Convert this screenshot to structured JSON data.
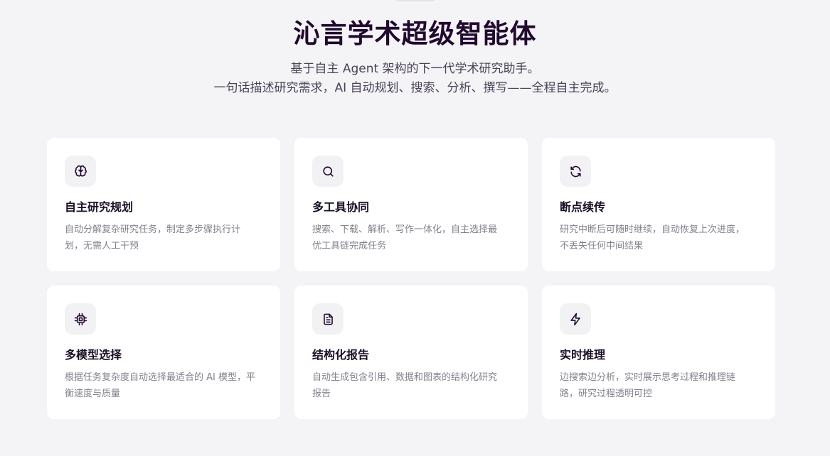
{
  "hero": {
    "title": "沁言学术超级智能体",
    "subtitle_line1": "基于自主 Agent 架构的下一代学术研究助手。",
    "subtitle_line2": "一句话描述研究需求，AI 自动规划、搜索、分析、撰写——全程自主完成。"
  },
  "features": [
    {
      "icon": "brain-icon",
      "title": "自主研究规划",
      "desc": "自动分解复杂研究任务，制定多步骤执行计划，无需人工干预"
    },
    {
      "icon": "search-icon",
      "title": "多工具协同",
      "desc": "搜索、下载、解析、写作一体化，自主选择最优工具链完成任务"
    },
    {
      "icon": "refresh-icon",
      "title": "断点续传",
      "desc": "研究中断后可随时继续，自动恢复上次进度，不丢失任何中间结果"
    },
    {
      "icon": "cpu-icon",
      "title": "多模型选择",
      "desc": "根据任务复杂度自动选择最适合的 AI 模型，平衡速度与质量"
    },
    {
      "icon": "document-icon",
      "title": "结构化报告",
      "desc": "自动生成包含引用、数据和图表的结构化研究报告"
    },
    {
      "icon": "lightning-icon",
      "title": "实时推理",
      "desc": "边搜索边分析，实时展示思考过程和推理链路，研究过程透明可控"
    }
  ],
  "colors": {
    "background": "#f4f4f6",
    "card": "#ffffff",
    "title": "#22092f",
    "muted": "#85808c"
  }
}
